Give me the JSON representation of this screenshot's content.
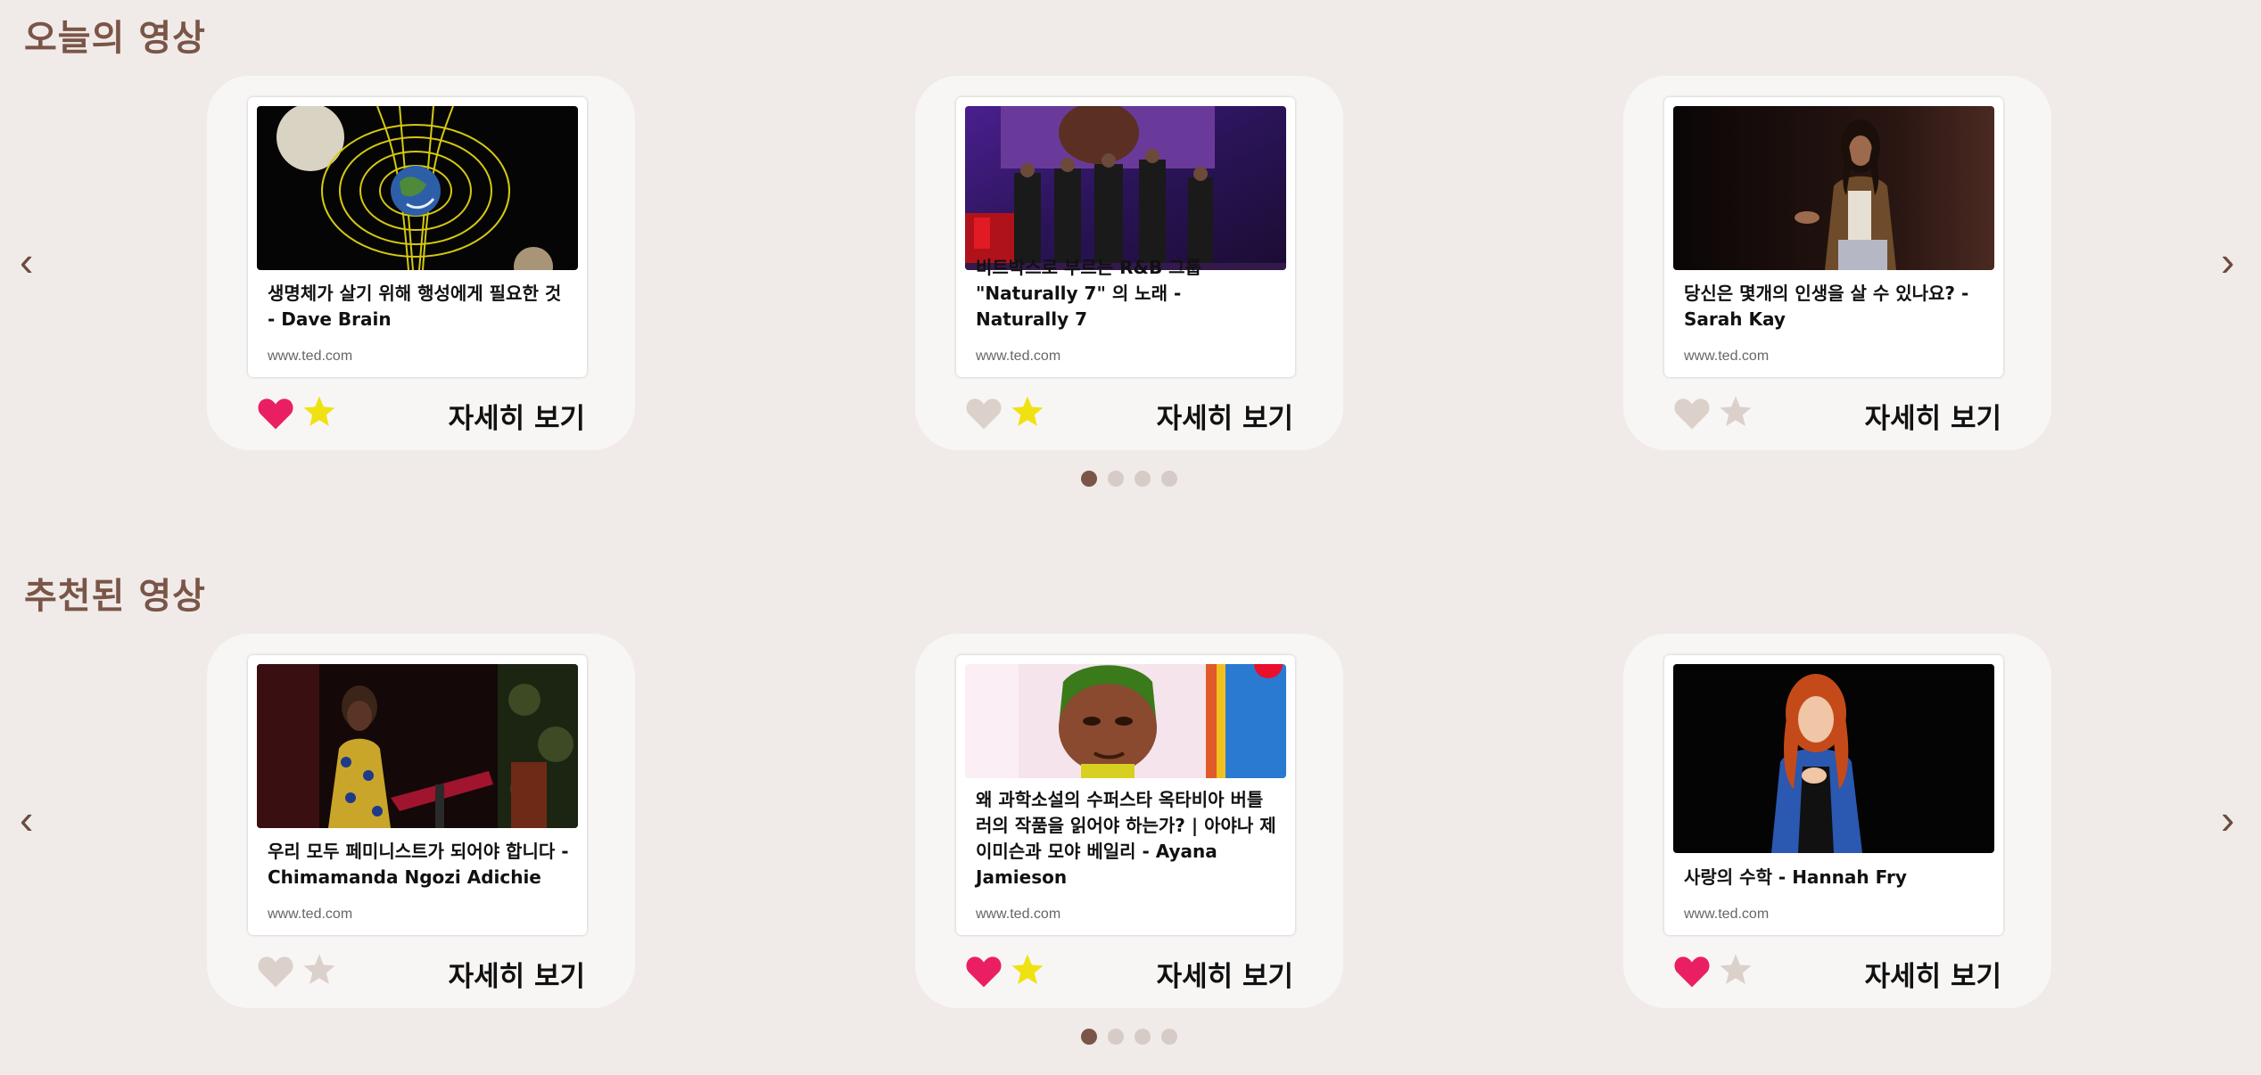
{
  "sections": [
    {
      "title": "오늘의 영상",
      "prev_arrow": "‹",
      "next_arrow": "›",
      "cards": [
        {
          "title": "생명체가 살기 위해 행성에게 필요한 것 - Dave Brain",
          "source": "www.ted.com",
          "liked": true,
          "starred": true,
          "more_label": "자세히 보기"
        },
        {
          "title": "비트박스로 부르는 R&B 그룹 \"Naturally 7\" 의 노래 - Naturally 7",
          "source": "www.ted.com",
          "liked": false,
          "starred": true,
          "more_label": "자세히 보기"
        },
        {
          "title": "당신은 몇개의 인생을 살 수 있나요? - Sarah Kay",
          "source": "www.ted.com",
          "liked": false,
          "starred": false,
          "more_label": "자세히 보기"
        }
      ],
      "page_count": 4,
      "active_page": 1
    },
    {
      "title": "추천된 영상",
      "prev_arrow": "‹",
      "next_arrow": "›",
      "cards": [
        {
          "title": "우리 모두 페미니스트가 되어야 합니다 - Chimamanda Ngozi Adichie",
          "source": "www.ted.com",
          "liked": false,
          "starred": false,
          "more_label": "자세히 보기"
        },
        {
          "title": "왜 과학소설의 수퍼스타 옥타비아 버틀러의 작품을 읽어야 하는가? | 아야나 제이미슨과 모야 베일리 - Ayana Jamieson",
          "source": "www.ted.com",
          "liked": true,
          "starred": true,
          "more_label": "자세히 보기"
        },
        {
          "title": "사랑의 수학 - Hannah Fry",
          "source": "www.ted.com",
          "liked": true,
          "starred": false,
          "more_label": "자세히 보기"
        }
      ],
      "page_count": 4,
      "active_page": 1
    }
  ],
  "icons": {
    "heart": "heart-icon",
    "star": "star-icon",
    "prev": "chevron-left-icon",
    "next": "chevron-right-icon"
  },
  "colors": {
    "background": "#f0ebe8",
    "title": "#7a5548",
    "heart_on": "#ea1f63",
    "heart_off": "#dcd0cb",
    "star_on": "#f0e212",
    "star_off": "#dcd0cb",
    "dot_active": "#7a5548",
    "dot_inactive": "#d6cbc6"
  }
}
